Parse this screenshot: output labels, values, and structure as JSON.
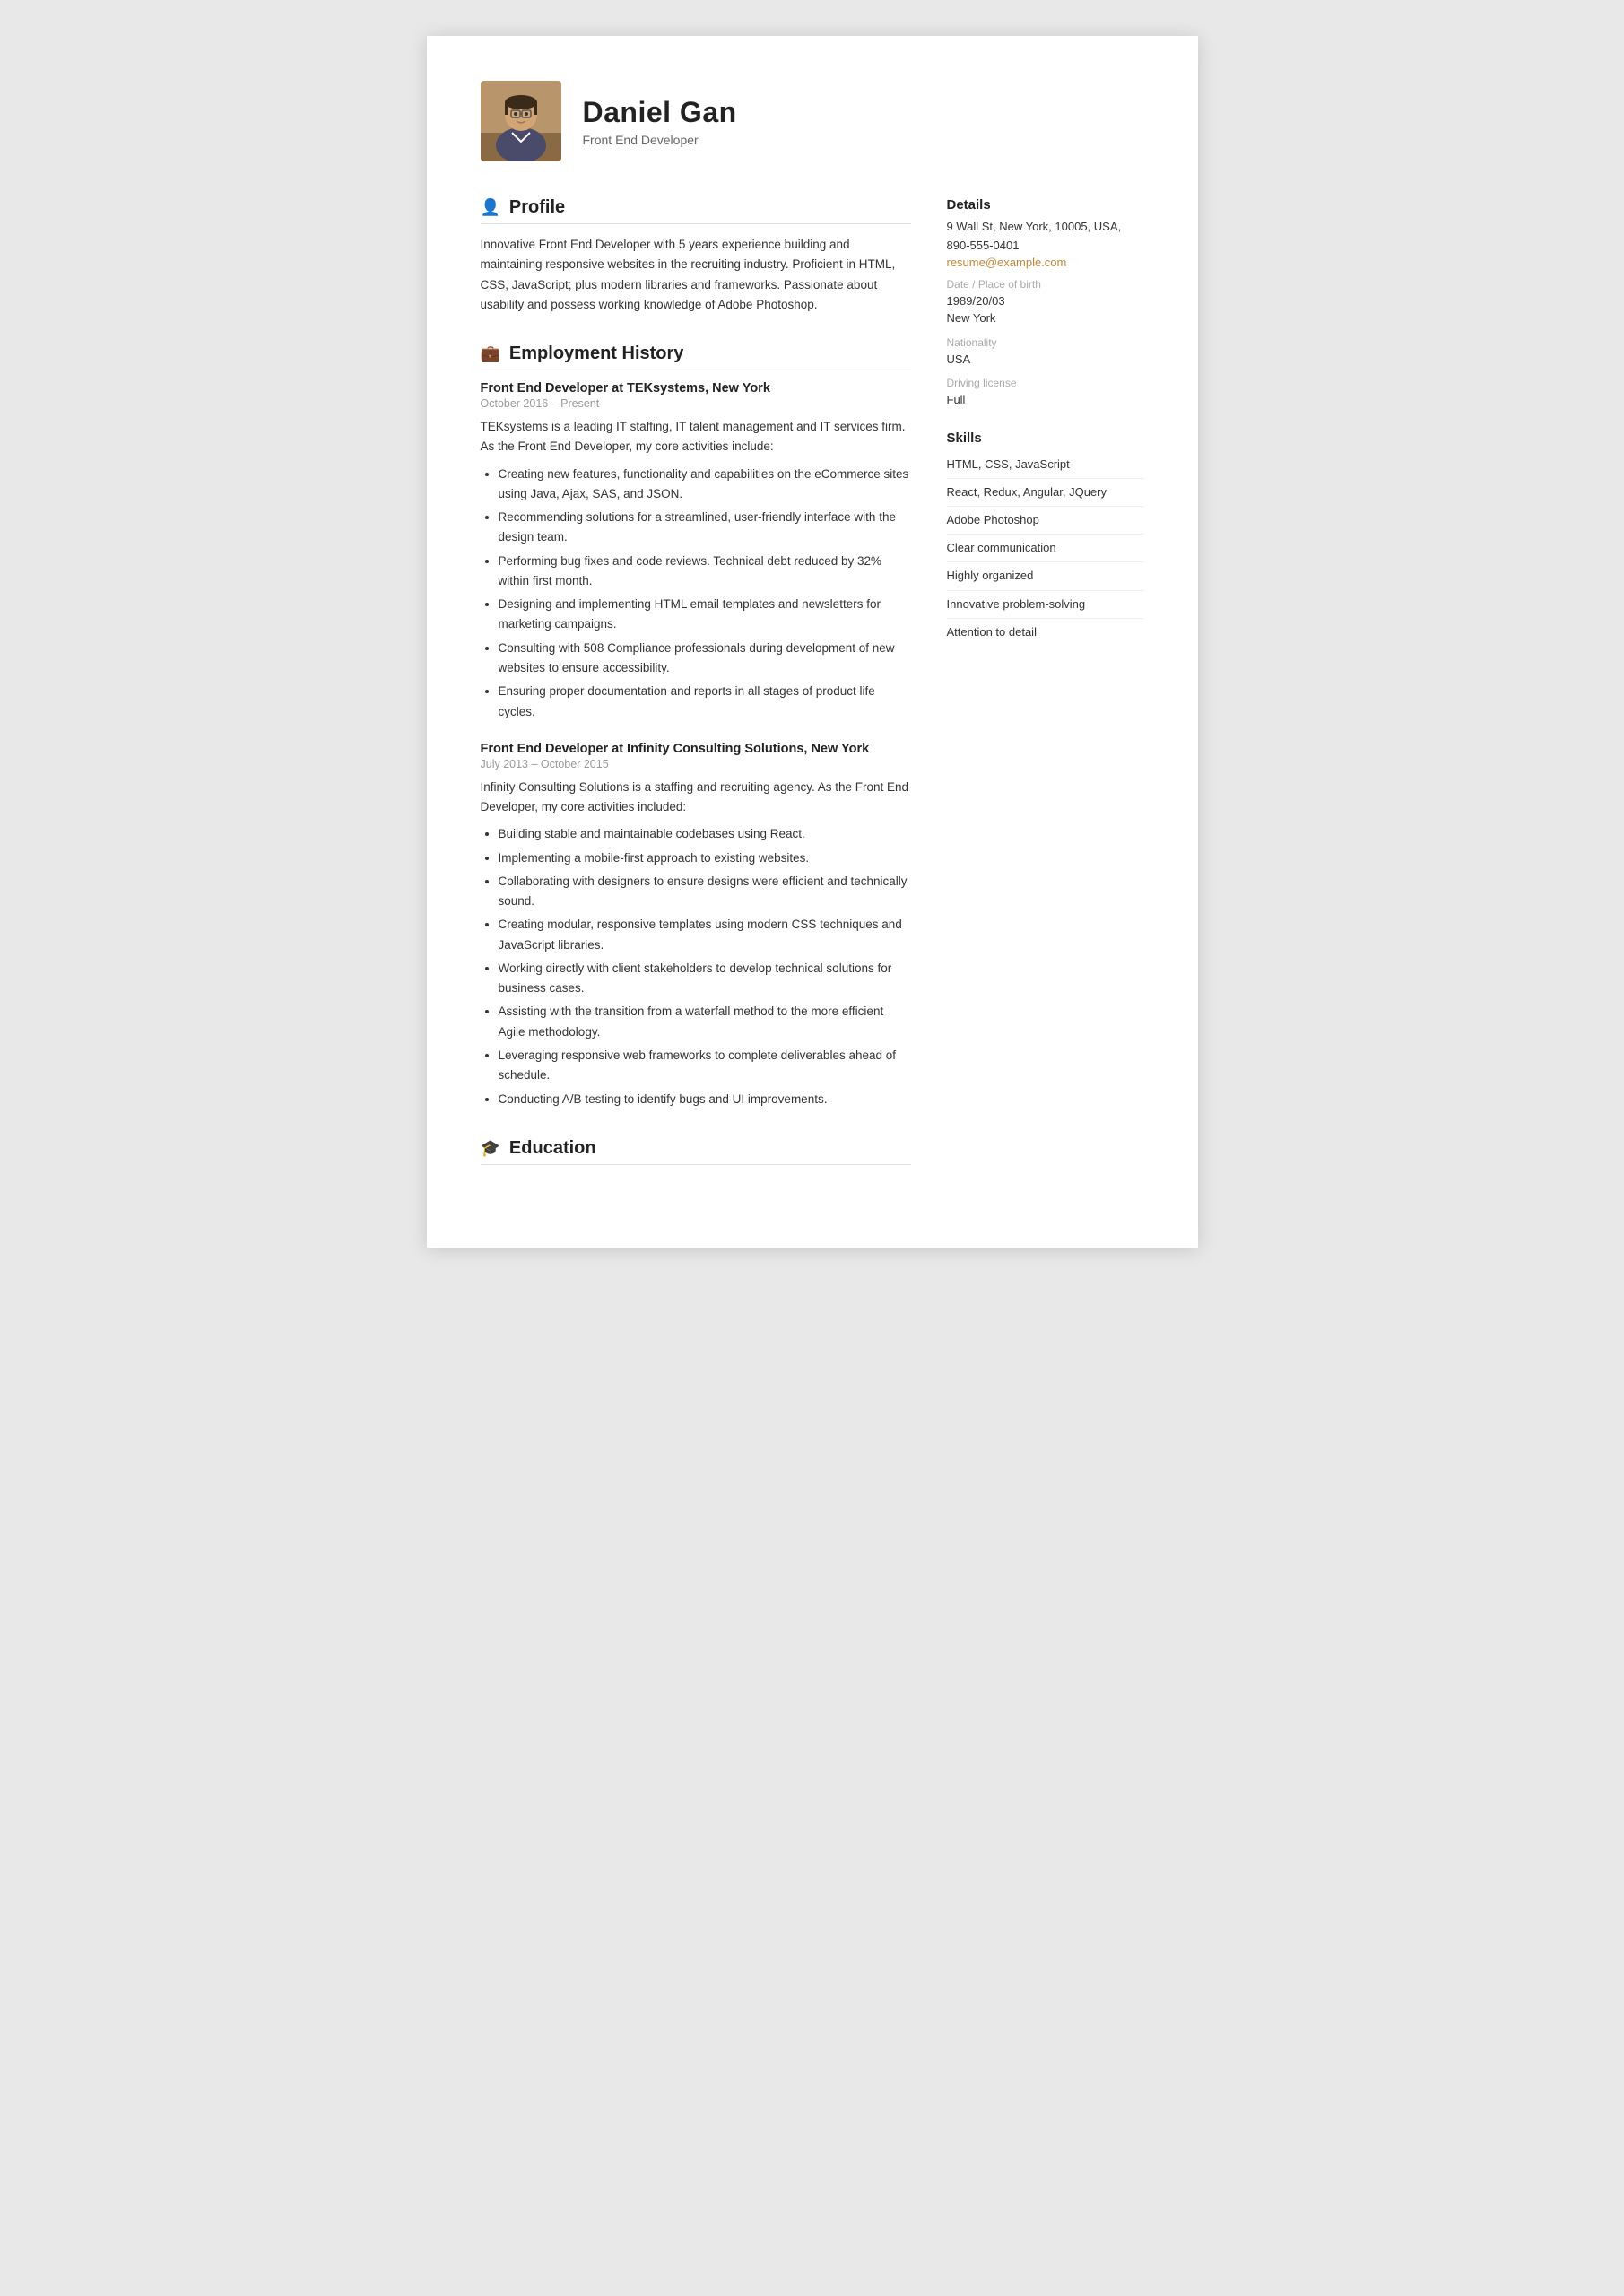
{
  "header": {
    "name": "Daniel Gan",
    "title": "Front End Developer"
  },
  "profile": {
    "section_title": "Profile",
    "text": "Innovative Front End Developer with 5 years experience building and maintaining responsive websites in the recruiting industry. Proficient in HTML, CSS, JavaScript; plus modern libraries and frameworks. Passionate about usability and possess working knowledge of Adobe Photoshop."
  },
  "employment": {
    "section_title": "Employment History",
    "jobs": [
      {
        "title": "Front End Developer at TEKsystems, New York",
        "dates": "October 2016 – Present",
        "description": "TEKsystems is a leading IT staffing, IT talent management and IT services firm. As the Front End Developer, my core activities include:",
        "bullets": [
          "Creating new features, functionality and capabilities on the eCommerce sites using Java, Ajax, SAS, and JSON.",
          "Recommending solutions for a streamlined, user-friendly interface with the design team.",
          "Performing bug fixes and code reviews. Technical debt reduced by 32% within first month.",
          "Designing and implementing HTML email templates and newsletters for marketing campaigns.",
          "Consulting with 508 Compliance professionals during development of new websites to ensure accessibility.",
          "Ensuring proper documentation and reports in all stages of product life cycles."
        ]
      },
      {
        "title": "Front End Developer at Infinity Consulting Solutions, New York",
        "dates": "July 2013 – October 2015",
        "description": "Infinity Consulting Solutions is a staffing and recruiting agency. As the Front End Developer, my core activities included:",
        "bullets": [
          "Building stable and maintainable codebases using React.",
          "Implementing a mobile-first approach to existing websites.",
          "Collaborating with designers to ensure designs were efficient and technically sound.",
          "Creating modular, responsive templates using modern CSS techniques and JavaScript libraries.",
          "Working directly with client stakeholders to develop technical solutions for business cases.",
          "Assisting with the transition from a waterfall method to the more efficient Agile methodology.",
          "Leveraging responsive web frameworks to complete deliverables ahead of schedule.",
          "Conducting A/B testing to identify bugs and UI improvements."
        ]
      }
    ]
  },
  "education": {
    "section_title": "Education"
  },
  "details": {
    "section_title": "Details",
    "address": "9 Wall St, New York, 10005, USA,",
    "phone": "890-555-0401",
    "email": "resume@example.com",
    "dob_label": "Date / Place of birth",
    "dob": "1989/20/03",
    "birthplace": "New York",
    "nationality_label": "Nationality",
    "nationality": "USA",
    "license_label": "Driving license",
    "license": "Full"
  },
  "skills": {
    "section_title": "Skills",
    "items": [
      "HTML, CSS, JavaScript",
      "React, Redux, Angular, JQuery",
      "Adobe Photoshop",
      "Clear communication",
      "Highly organized",
      "Innovative problem-solving",
      "Attention to detail"
    ]
  },
  "icons": {
    "profile": "👤",
    "employment": "💼",
    "education": "🎓"
  }
}
